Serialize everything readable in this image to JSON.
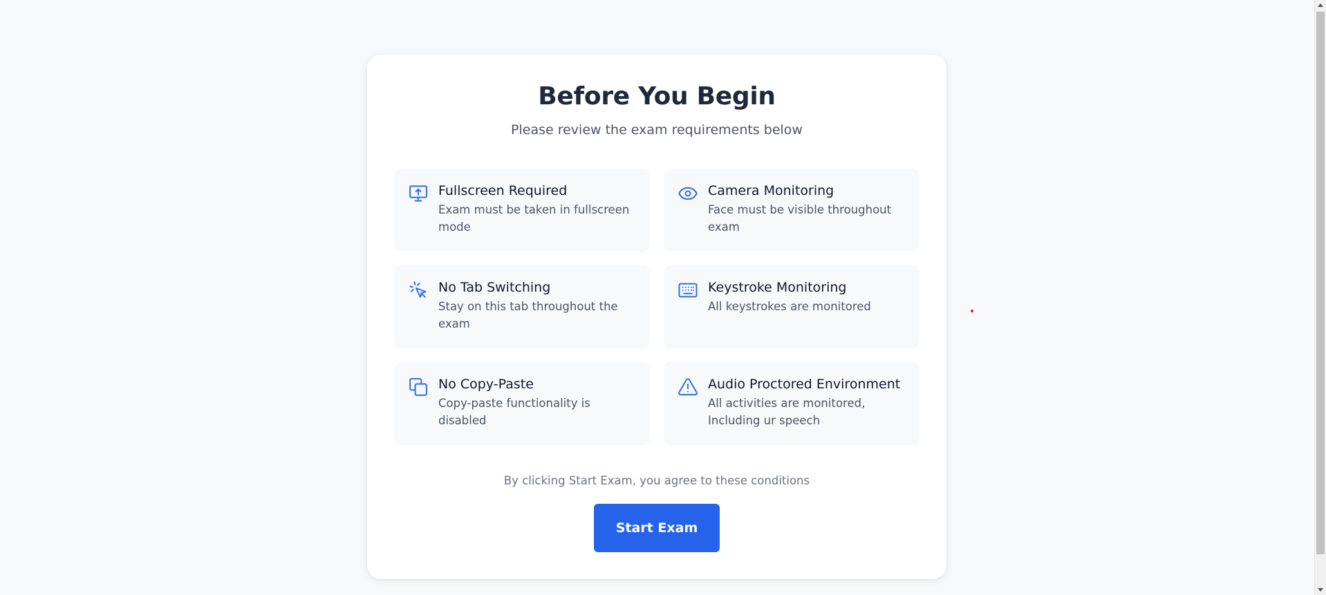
{
  "header": {
    "title": "Before You Begin",
    "subtitle": "Please review the exam requirements below"
  },
  "requirements": [
    {
      "icon": "monitor-upload-icon",
      "title": "Fullscreen Required",
      "description": "Exam must be taken in fullscreen mode"
    },
    {
      "icon": "eye-icon",
      "title": "Camera Monitoring",
      "description": "Face must be visible throughout exam"
    },
    {
      "icon": "cursor-click-icon",
      "title": "No Tab Switching",
      "description": "Stay on this tab throughout the exam"
    },
    {
      "icon": "keyboard-icon",
      "title": "Keystroke Monitoring",
      "description": "All keystrokes are monitored"
    },
    {
      "icon": "copy-icon",
      "title": "No Copy-Paste",
      "description": "Copy-paste functionality is disabled"
    },
    {
      "icon": "warning-triangle-icon",
      "title": "Audio Proctored Environment",
      "description": "All activities are monitored, Including ur speech"
    }
  ],
  "footer": {
    "agreement": "By clicking Start Exam, you agree to these conditions",
    "start_label": "Start Exam"
  },
  "colors": {
    "accent": "#2563eb",
    "icon": "#2f6fe4",
    "background": "#f8f9fb",
    "card": "#ffffff",
    "marker": "#e11d1d"
  }
}
